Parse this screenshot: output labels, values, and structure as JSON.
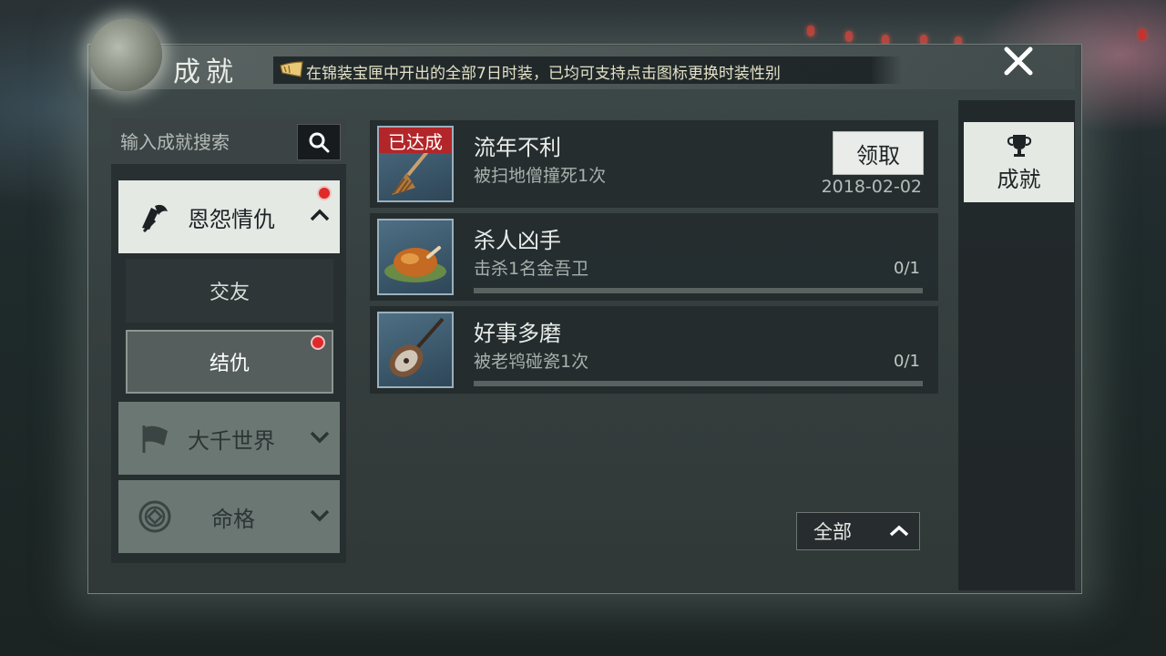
{
  "header": {
    "title": "成就",
    "announcement": "在锦装宝匣中开出的全部7日时装，已均可支持点击图标更换时装性别",
    "close_icon": "close-icon"
  },
  "search": {
    "placeholder": "输入成就搜索",
    "icon": "search-icon"
  },
  "sidebar": {
    "categories": [
      {
        "label": "恩怨情仇",
        "state": "expanded",
        "has_notification": true,
        "icon": "scroll-icon"
      },
      {
        "label": "大千世界",
        "state": "collapsed",
        "has_notification": false,
        "icon": "flag-icon"
      },
      {
        "label": "命格",
        "state": "collapsed",
        "has_notification": false,
        "icon": "coin-icon"
      }
    ],
    "subcategories": [
      {
        "label": "交友",
        "selected": false,
        "has_notification": false
      },
      {
        "label": "结仇",
        "selected": true,
        "has_notification": true
      }
    ]
  },
  "achievements": [
    {
      "name": "流年不利",
      "desc": "被扫地僧撞死1次",
      "badge": "已达成",
      "action": "领取",
      "date": "2018-02-02",
      "icon": "broom-icon"
    },
    {
      "name": "杀人凶手",
      "desc": "击杀1名金吾卫",
      "progress": "0/1",
      "progress_value": 0,
      "icon": "roast-chicken-icon"
    },
    {
      "name": "好事多磨",
      "desc": "被老鸨碰瓷1次",
      "progress": "0/1",
      "progress_value": 0,
      "icon": "pipa-icon"
    }
  ],
  "filter": {
    "label": "全部"
  },
  "right_tabs": [
    {
      "label": "成就",
      "icon": "trophy-icon",
      "active": true
    }
  ],
  "colors": {
    "accent_red": "#e02a2a",
    "badge_red": "#b2262a",
    "panel_light": "#e4e9e4"
  }
}
